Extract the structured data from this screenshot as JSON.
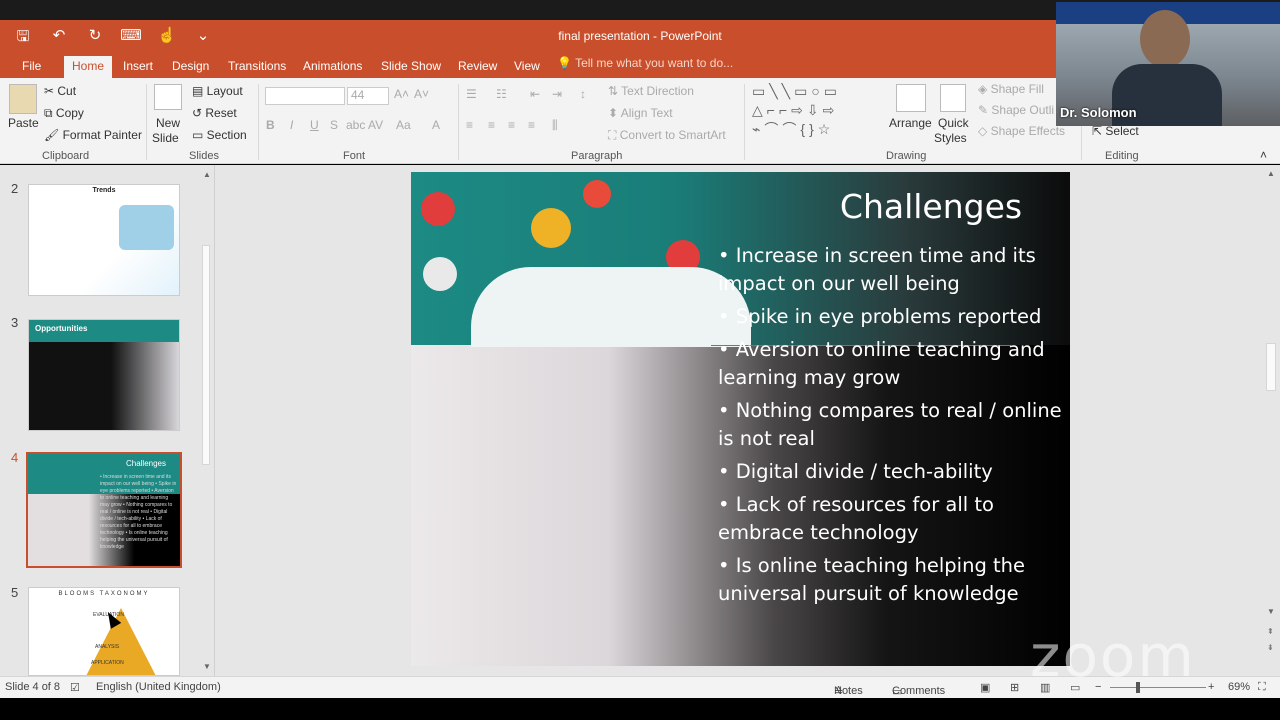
{
  "app": {
    "title": "final presentation - PowerPoint"
  },
  "tabs": [
    "File",
    "Home",
    "Insert",
    "Design",
    "Transitions",
    "Animations",
    "Slide Show",
    "Review",
    "View"
  ],
  "tellme": "Tell me what you want to do...",
  "ribbon": {
    "clipboard": {
      "paste": "Paste",
      "cut": "Cut",
      "copy": "Copy",
      "format_painter": "Format Painter",
      "label": "Clipboard"
    },
    "slides": {
      "new_slide": "New",
      "new_slide2": "Slide",
      "layout": "Layout",
      "reset": "Reset",
      "section": "Section",
      "label": "Slides"
    },
    "font": {
      "size": "44",
      "label": "Font"
    },
    "paragraph": {
      "text_direction": "Text Direction",
      "align_text": "Align Text",
      "smartart": "Convert to SmartArt",
      "label": "Paragraph"
    },
    "drawing": {
      "arrange": "Arrange",
      "quick_styles": "Quick",
      "quick_styles2": "Styles",
      "shape_fill": "Shape Fill",
      "shape_outline": "Shape Outli",
      "shape_effects": "Shape Effects",
      "label": "Drawing"
    },
    "editing": {
      "select": "Select",
      "label": "Editing"
    }
  },
  "thumbs": [
    {
      "num": "2",
      "title": "Trends"
    },
    {
      "num": "3",
      "title": "Opportunities"
    },
    {
      "num": "4",
      "title": "Challenges"
    },
    {
      "num": "5",
      "title": "BLOOMS TAXONOMY",
      "sub1": "EVALUATION",
      "sub2": "ANALYSIS",
      "sub3": "APPLICATION"
    }
  ],
  "slide": {
    "title": "Challenges",
    "bullets": [
      "• Increase in screen time and its impact on our well being",
      "• Spike in eye problems reported",
      "• Aversion to online teaching and learning may grow",
      "• Nothing compares to real / online is not real",
      "• Digital divide / tech-ability",
      "• Lack of resources for all to embrace technology",
      "• Is online teaching helping the universal pursuit of knowledge"
    ]
  },
  "status": {
    "slide_of": "Slide 4 of 8",
    "language": "English (United Kingdom)",
    "notes": "Notes",
    "comments": "Comments",
    "zoom": "69%"
  },
  "video": {
    "name": "Dr. Solomon"
  },
  "watermark": "zoom",
  "colors": {
    "accent": "#c94f2c"
  }
}
